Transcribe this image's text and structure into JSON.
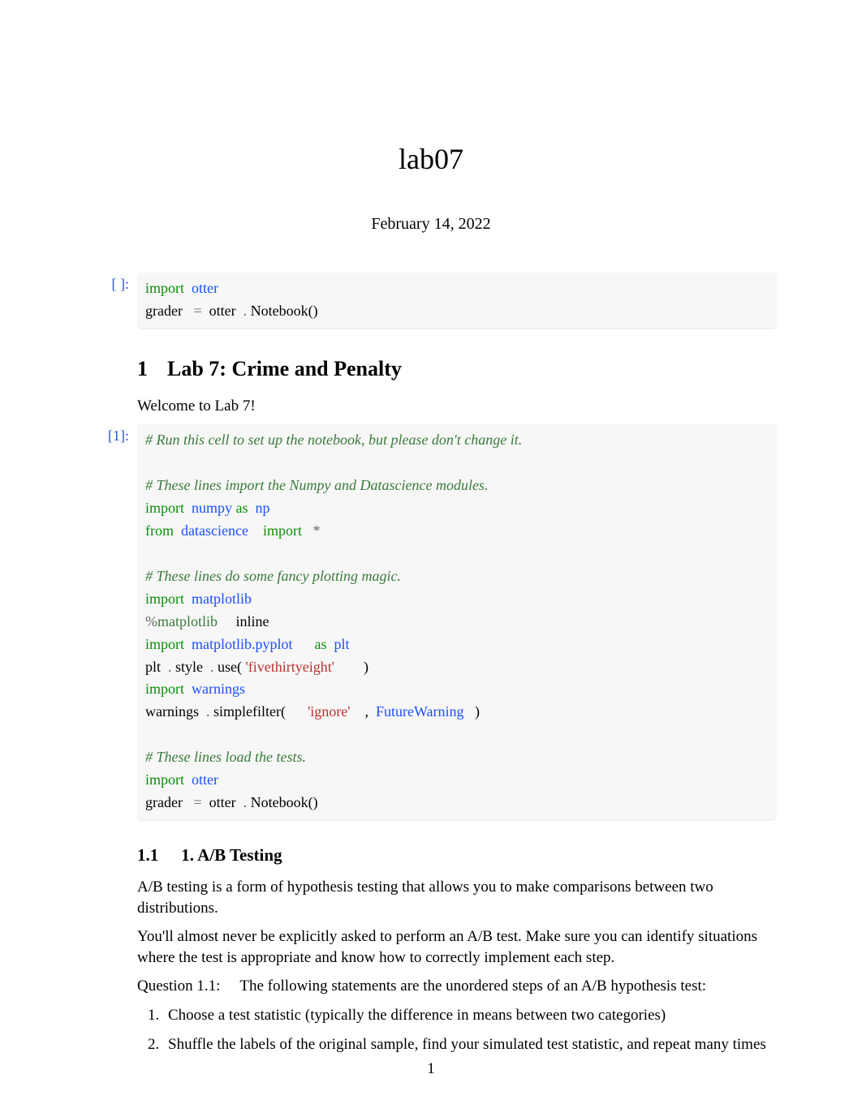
{
  "title": "lab07",
  "date": "February 14, 2022",
  "cells": [
    {
      "prompt": "[ ]:",
      "tokens": [
        [
          {
            "t": "import",
            "c": "kw"
          },
          {
            "t": "  "
          },
          {
            "t": "otter",
            "c": "mod"
          }
        ],
        [
          {
            "t": "grader   "
          },
          {
            "t": "=",
            "c": "op"
          },
          {
            "t": "  otter  "
          },
          {
            "t": ".",
            "c": "op"
          },
          {
            "t": " Notebook()"
          }
        ]
      ]
    },
    {
      "prompt": "[1]:",
      "tokens": [
        [
          {
            "t": "# Run this cell to set up the notebook, but please don't change it.",
            "c": "cmt"
          }
        ],
        [],
        [
          {
            "t": "# These lines import the Numpy and Datascience modules.",
            "c": "cmt"
          }
        ],
        [
          {
            "t": "import",
            "c": "kw"
          },
          {
            "t": "  "
          },
          {
            "t": "numpy",
            "c": "mod"
          },
          {
            "t": " "
          },
          {
            "t": "as",
            "c": "kw"
          },
          {
            "t": "  "
          },
          {
            "t": "np",
            "c": "mod"
          }
        ],
        [
          {
            "t": "from",
            "c": "kw"
          },
          {
            "t": "  "
          },
          {
            "t": "datascience",
            "c": "mod"
          },
          {
            "t": "    "
          },
          {
            "t": "import",
            "c": "kw"
          },
          {
            "t": "   "
          },
          {
            "t": "*",
            "c": "op"
          }
        ],
        [],
        [
          {
            "t": "# These lines do some fancy plotting magic.",
            "c": "cmt"
          }
        ],
        [
          {
            "t": "import",
            "c": "kw"
          },
          {
            "t": "  "
          },
          {
            "t": "matplotlib",
            "c": "mod"
          }
        ],
        [
          {
            "t": "%",
            "c": "op"
          },
          {
            "t": "matplotlib",
            "c": "magic"
          },
          {
            "t": "     inline"
          }
        ],
        [
          {
            "t": "import",
            "c": "kw"
          },
          {
            "t": "  "
          },
          {
            "t": "matplotlib.pyplot",
            "c": "mod"
          },
          {
            "t": "      "
          },
          {
            "t": "as",
            "c": "kw"
          },
          {
            "t": "  "
          },
          {
            "t": "plt",
            "c": "mod"
          }
        ],
        [
          {
            "t": "plt  "
          },
          {
            "t": ".",
            "c": "op"
          },
          {
            "t": " style  "
          },
          {
            "t": ".",
            "c": "op"
          },
          {
            "t": " use( "
          },
          {
            "t": "'fivethirtyeight'",
            "c": "str"
          },
          {
            "t": "        )"
          }
        ],
        [
          {
            "t": "import",
            "c": "kw"
          },
          {
            "t": "  "
          },
          {
            "t": "warnings",
            "c": "mod"
          }
        ],
        [
          {
            "t": "warnings  "
          },
          {
            "t": ".",
            "c": "op"
          },
          {
            "t": " simplefilter(      "
          },
          {
            "t": "'ignore'",
            "c": "str"
          },
          {
            "t": "    ,  "
          },
          {
            "t": "FutureWarning",
            "c": "cls"
          },
          {
            "t": "   )"
          }
        ],
        [],
        [
          {
            "t": "# These lines load the tests.",
            "c": "cmt"
          }
        ],
        [
          {
            "t": "import",
            "c": "kw"
          },
          {
            "t": "  "
          },
          {
            "t": "otter",
            "c": "mod"
          }
        ],
        [
          {
            "t": "grader   "
          },
          {
            "t": "=",
            "c": "op"
          },
          {
            "t": "  otter  "
          },
          {
            "t": ".",
            "c": "op"
          },
          {
            "t": " Notebook()"
          }
        ]
      ]
    }
  ],
  "section": {
    "num": "1",
    "title": "Lab 7: Crime and Penalty",
    "welcome": "Welcome to Lab 7!"
  },
  "subsection": {
    "num": "1.1",
    "title": "1. A/B Testing",
    "para1": "A/B testing is a form of hypothesis testing that allows you to make comparisons between two distributions.",
    "para2": "You'll almost never be explicitly asked to perform an A/B test.       Make sure you can identify situations where the test is appropriate and know how to correctly implement each step.",
    "question_label": "Question 1.1:",
    "question_text": "The following statements are the unordered steps of an A/B hypothesis test:",
    "steps": [
      "Choose a test statistic (typically the difference in means between two categories)",
      "Shuffle the labels of the original sample, find your simulated test statistic, and repeat many times"
    ]
  },
  "page_number": "1"
}
